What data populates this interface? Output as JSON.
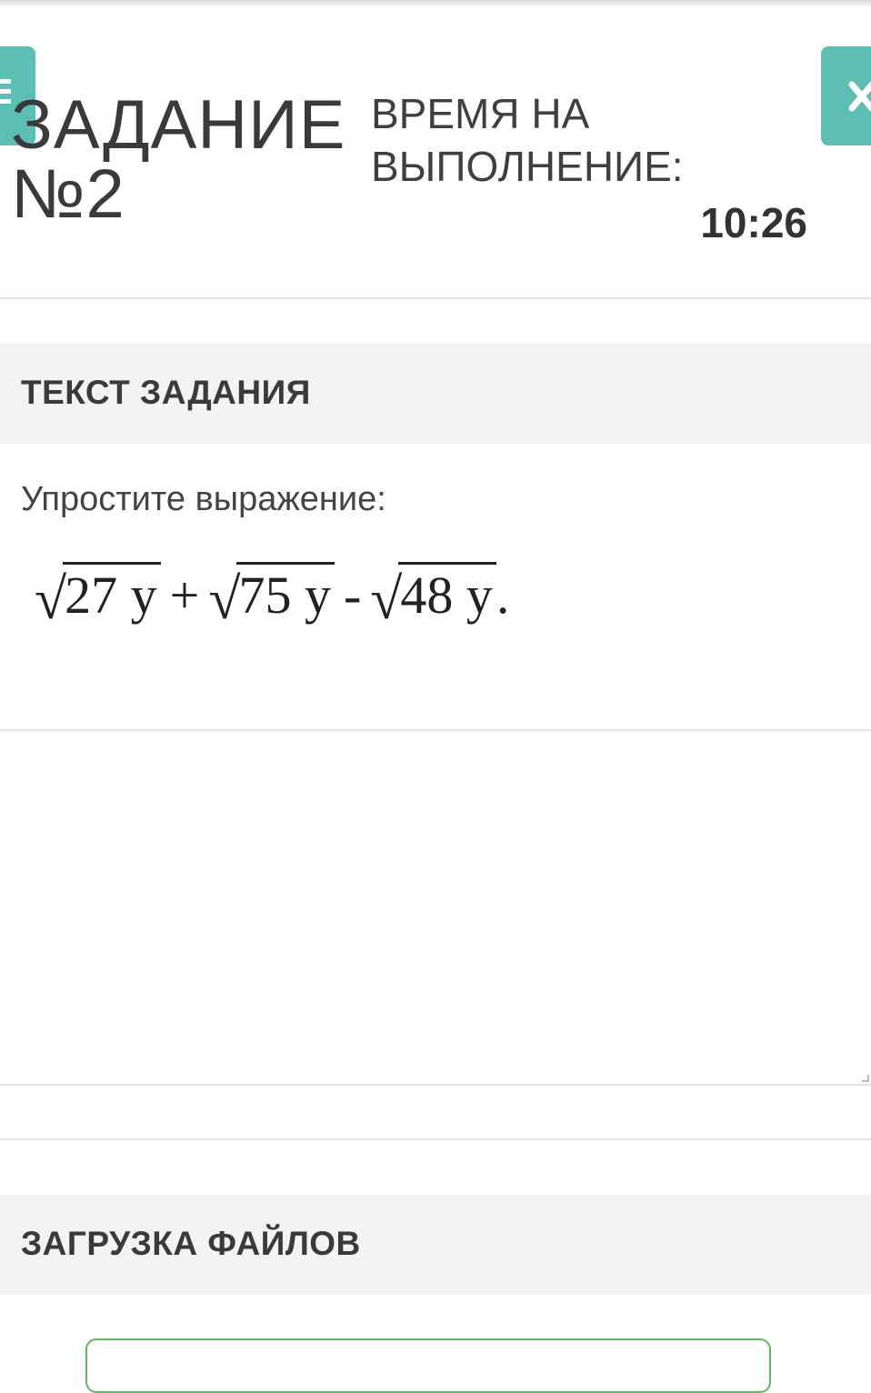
{
  "header": {
    "title_line1": "ЗАДАНИЕ",
    "title_line2": "№2",
    "time_label_line1": "ВРЕМЯ НА",
    "time_label_line2": "ВЫПОЛНЕНИЕ:",
    "timer": "10:26",
    "menu_icon": "hamburger-icon",
    "close_icon": "close-icon",
    "accent_color": "#5dbfb3"
  },
  "task": {
    "section_title": "ТЕКСТ ЗАДАНИЯ",
    "instruction": "Упростите выражение:",
    "formula": {
      "term1": "27 y",
      "op1": "+",
      "term2": "75 y",
      "op2": "-",
      "term3": "48 y",
      "suffix": "."
    }
  },
  "answer": {
    "value": ""
  },
  "upload": {
    "section_title": "ЗАГРУЗКА ФАЙЛОВ",
    "border_color": "#5cb85c"
  }
}
